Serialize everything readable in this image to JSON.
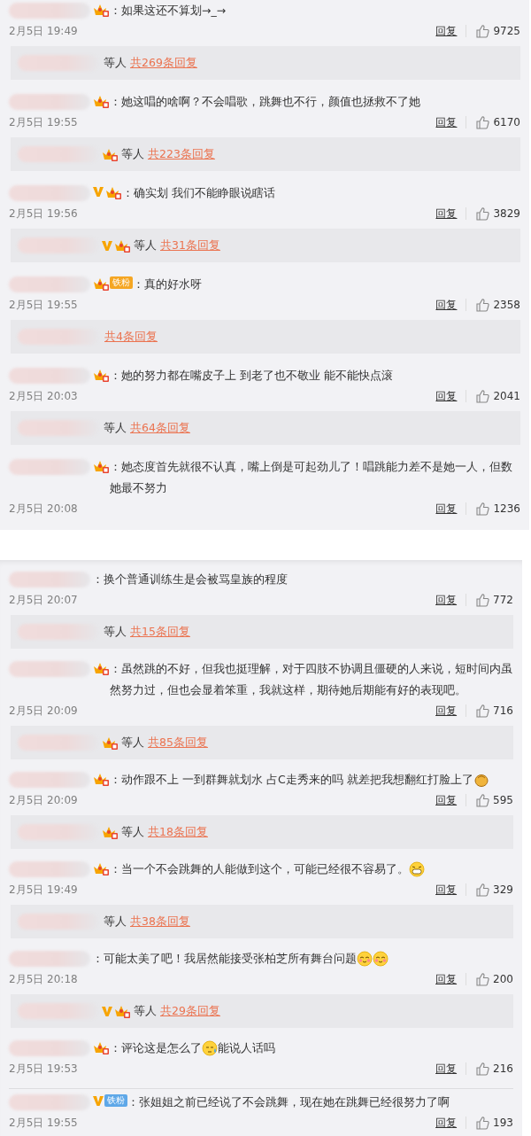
{
  "panels": [
    {
      "comments": [
        {
          "badges": [
            {
              "kind": "level"
            }
          ],
          "segments": [
            {
              "kind": "text",
              "text": "：如果这还不算划→_→"
            }
          ],
          "time": "2月5日 19:49",
          "reply_label": "回复",
          "likes": "9725",
          "replies": {
            "who": "等人",
            "count": "共269条回复"
          }
        },
        {
          "badges": [
            {
              "kind": "level"
            }
          ],
          "segments": [
            {
              "kind": "text",
              "text": "：她这唱的啥啊？不会唱歌，跳舞也不行，颜值也拯救不了她"
            }
          ],
          "time": "2月5日 19:55",
          "reply_label": "回复",
          "likes": "6170",
          "replies": {
            "badges": [
              {
                "kind": "level"
              }
            ],
            "who": "等人",
            "count": "共223条回复"
          }
        },
        {
          "badges": [
            {
              "kind": "verified"
            },
            {
              "kind": "level"
            }
          ],
          "segments": [
            {
              "kind": "text",
              "text": "：确实划 我们不能睁眼说瞎话"
            }
          ],
          "time": "2月5日 19:56",
          "reply_label": "回复",
          "likes": "3829",
          "replies": {
            "badges": [
              {
                "kind": "verified"
              },
              {
                "kind": "level"
              }
            ],
            "who": "等人",
            "count": "共31条回复"
          }
        },
        {
          "badges": [
            {
              "kind": "level"
            },
            {
              "kind": "fan",
              "label": "铁粉",
              "color": "#f5a623"
            }
          ],
          "segments": [
            {
              "kind": "text",
              "text": "：真的好水呀"
            }
          ],
          "time": "2月5日 19:55",
          "reply_label": "回复",
          "likes": "2358",
          "replies": {
            "count": "共4条回复"
          }
        },
        {
          "badges": [
            {
              "kind": "level"
            }
          ],
          "segments": [
            {
              "kind": "text",
              "text": "：她的努力都在嘴皮子上 到老了也不敬业 能不能快点滚"
            }
          ],
          "time": "2月5日 20:03",
          "reply_label": "回复",
          "likes": "2041",
          "replies": {
            "who": "等人",
            "count": "共64条回复"
          }
        },
        {
          "badges": [
            {
              "kind": "level"
            }
          ],
          "segments": [
            {
              "kind": "text",
              "text": "：她态度首先就很不认真，嘴上倒是可起劲儿了！唱跳能力差不是她一人，但数她最不努力"
            }
          ],
          "time": "2月5日 20:08",
          "reply_label": "回复",
          "likes": "1236"
        }
      ]
    },
    {
      "comments": [
        {
          "segments": [
            {
              "kind": "text",
              "text": "：换个普通训练生是会被骂皇族的程度"
            }
          ],
          "time": "2月5日 20:07",
          "reply_label": "回复",
          "likes": "772",
          "replies": {
            "who": "等人",
            "count": "共15条回复"
          }
        },
        {
          "badges": [
            {
              "kind": "level"
            }
          ],
          "segments": [
            {
              "kind": "text",
              "text": "：虽然跳的不好，但我也挺理解，对于四肢不协调且僵硬的人来说，短时间内虽然努力过，但也会显着笨重，我就这样，期待她后期能有好的表现吧。"
            }
          ],
          "time": "2月5日 20:09",
          "reply_label": "回复",
          "likes": "716",
          "replies": {
            "badges": [
              {
                "kind": "level"
              }
            ],
            "who": "等人",
            "count": "共85条回复"
          }
        },
        {
          "badges": [
            {
              "kind": "level"
            }
          ],
          "segments": [
            {
              "kind": "text",
              "text": "：动作跟不上 一到群舞就划水 占C走秀来的吗 就差把我想翻红打脸上了"
            },
            {
              "kind": "clap"
            }
          ],
          "time": "2月5日 20:09",
          "reply_label": "回复",
          "likes": "595",
          "replies": {
            "badges": [
              {
                "kind": "level"
              }
            ],
            "who": "等人",
            "count": "共18条回复"
          }
        },
        {
          "badges": [
            {
              "kind": "level"
            }
          ],
          "segments": [
            {
              "kind": "text",
              "text": "：当一个不会跳舞的人能做到这个，可能已经很不容易了。"
            },
            {
              "kind": "grin"
            }
          ],
          "time": "2月5日 19:49",
          "reply_label": "回复",
          "likes": "329",
          "replies": {
            "who": "等人",
            "count": "共38条回复"
          }
        },
        {
          "segments": [
            {
              "kind": "text",
              "text": "：可能太美了吧！我居然能接受张柏芝所有舞台问题"
            },
            {
              "kind": "blush"
            },
            {
              "kind": "blush"
            }
          ],
          "time": "2月5日 20:18",
          "reply_label": "回复",
          "likes": "200",
          "replies": {
            "badges": [
              {
                "kind": "verified"
              },
              {
                "kind": "level"
              }
            ],
            "who": "等人",
            "count": "共29条回复"
          }
        },
        {
          "badges": [
            {
              "kind": "level"
            }
          ],
          "segments": [
            {
              "kind": "text",
              "text": "：评论这是怎么了"
            },
            {
              "kind": "sweat"
            },
            {
              "kind": "text",
              "text": "能说人话吗"
            }
          ],
          "time": "2月5日 19:53",
          "reply_label": "回复",
          "likes": "216"
        },
        {
          "divider": true,
          "badges": [
            {
              "kind": "verified"
            },
            {
              "kind": "fan",
              "label": "铁粉",
              "color": "#5fa8e8"
            }
          ],
          "segments": [
            {
              "kind": "text",
              "text": "：张姐姐之前已经说了不会跳舞，现在她在跳舞已经很努力了啊"
            }
          ],
          "time": "2月5日 19:55",
          "reply_label": "回复",
          "likes": "193"
        }
      ]
    }
  ]
}
